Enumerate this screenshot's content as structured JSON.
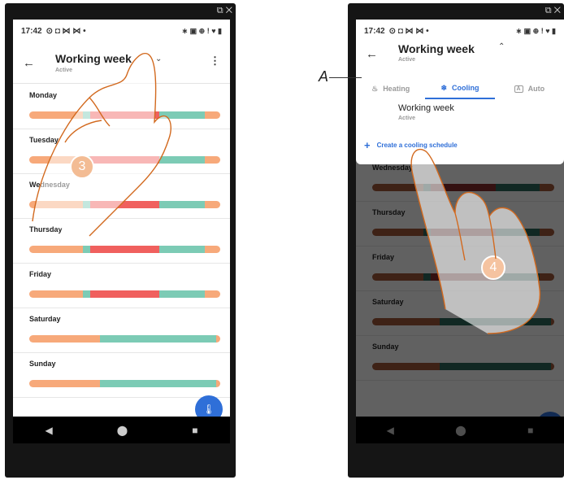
{
  "status": {
    "time": "17:42",
    "left_icons": "⊙ ◘ ⋈ ⋈ •",
    "right_icons": "∗ ▣ ⊕ ! ♥ ▮"
  },
  "left": {
    "title": "Working week",
    "subtitle": "Active",
    "days": [
      {
        "label": "Monday",
        "segments": [
          [
            "#f7a97a",
            28
          ],
          [
            "#7ccbb5",
            4
          ],
          [
            "#f0605e",
            36
          ],
          [
            "#7ccbb5",
            24
          ],
          [
            "#f7a97a",
            8
          ]
        ]
      },
      {
        "label": "Tuesday",
        "segments": [
          [
            "#f7a97a",
            28
          ],
          [
            "#7ccbb5",
            4
          ],
          [
            "#f0605e",
            36
          ],
          [
            "#7ccbb5",
            24
          ],
          [
            "#f7a97a",
            8
          ]
        ]
      },
      {
        "label": "Wednesday",
        "segments": [
          [
            "#f7a97a",
            28
          ],
          [
            "#7ccbb5",
            4
          ],
          [
            "#f0605e",
            36
          ],
          [
            "#7ccbb5",
            24
          ],
          [
            "#f7a97a",
            8
          ]
        ]
      },
      {
        "label": "Thursday",
        "segments": [
          [
            "#f7a97a",
            28
          ],
          [
            "#7ccbb5",
            4
          ],
          [
            "#f0605e",
            36
          ],
          [
            "#7ccbb5",
            24
          ],
          [
            "#f7a97a",
            8
          ]
        ]
      },
      {
        "label": "Friday",
        "segments": [
          [
            "#f7a97a",
            28
          ],
          [
            "#7ccbb5",
            4
          ],
          [
            "#f0605e",
            36
          ],
          [
            "#7ccbb5",
            24
          ],
          [
            "#f7a97a",
            8
          ]
        ]
      },
      {
        "label": "Saturday",
        "segments": [
          [
            "#f7a97a",
            37
          ],
          [
            "#7ccbb5",
            61
          ],
          [
            "#f7a97a",
            2
          ]
        ]
      },
      {
        "label": "Sunday",
        "segments": [
          [
            "#f7a97a",
            37
          ],
          [
            "#7ccbb5",
            61
          ],
          [
            "#f7a97a",
            2
          ]
        ]
      }
    ]
  },
  "right": {
    "title": "Working week",
    "subtitle": "Active",
    "tabs": [
      {
        "icon": "flame-icon",
        "glyph": "♨",
        "label": "Heating",
        "active": false
      },
      {
        "icon": "snowflake-icon",
        "glyph": "❄",
        "label": "Cooling",
        "active": true
      },
      {
        "icon": "auto-icon",
        "glyph": "A",
        "label": "Auto",
        "active": false
      }
    ],
    "schedule_title": "Working week",
    "schedule_sub": "Active",
    "create_label": "Create a cooling schedule",
    "days": [
      {
        "label": "Wednesday",
        "segments": [
          [
            "#a45a3c",
            28
          ],
          [
            "#2e6a5d",
            4
          ],
          [
            "#8a2f2e",
            36
          ],
          [
            "#2e6a5d",
            24
          ],
          [
            "#a45a3c",
            8
          ]
        ]
      },
      {
        "label": "Thursday",
        "segments": [
          [
            "#a45a3c",
            28
          ],
          [
            "#2e6a5d",
            4
          ],
          [
            "#8a2f2e",
            36
          ],
          [
            "#2e6a5d",
            24
          ],
          [
            "#a45a3c",
            8
          ]
        ]
      },
      {
        "label": "Friday",
        "segments": [
          [
            "#a45a3c",
            28
          ],
          [
            "#2e6a5d",
            4
          ],
          [
            "#8a2f2e",
            36
          ],
          [
            "#2e6a5d",
            24
          ],
          [
            "#a45a3c",
            8
          ]
        ]
      },
      {
        "label": "Saturday",
        "segments": [
          [
            "#a45a3c",
            37
          ],
          [
            "#2e6a5d",
            61
          ],
          [
            "#a45a3c",
            2
          ]
        ]
      },
      {
        "label": "Sunday",
        "segments": [
          [
            "#a45a3c",
            37
          ],
          [
            "#2e6a5d",
            61
          ],
          [
            "#a45a3c",
            2
          ]
        ]
      }
    ]
  },
  "callout_letter": "A",
  "step3": "3",
  "step4": "4",
  "colors": {
    "accent": "#2f6fd8",
    "step": "#e56a12"
  }
}
